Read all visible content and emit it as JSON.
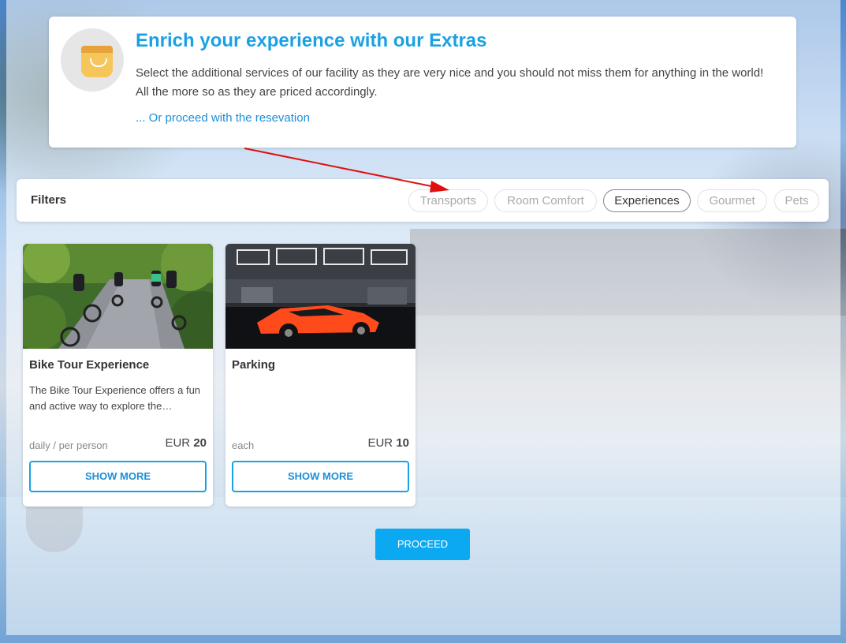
{
  "intro": {
    "title": "Enrich your experience with our Extras",
    "text": "Select the additional services of our facility as they are very nice and you should not miss them for anything in the world! All the more so as they are priced accordingly.",
    "link": "... Or proceed with the resevation",
    "icon": "shopping-bag-icon"
  },
  "filters": {
    "label": "Filters",
    "chips": [
      {
        "label": "Transports",
        "active": false
      },
      {
        "label": "Room Comfort",
        "active": false
      },
      {
        "label": "Experiences",
        "active": true
      },
      {
        "label": "Gourmet",
        "active": false
      },
      {
        "label": "Pets",
        "active": false
      }
    ]
  },
  "cards": [
    {
      "title": "Bike Tour Experience",
      "description": "The Bike Tour Experience offers a fun and active way to explore the…",
      "unit": "daily / per person",
      "currency": "EUR",
      "price": "20",
      "button": "SHOW MORE"
    },
    {
      "title": "Parking",
      "description": "",
      "unit": "each",
      "currency": "EUR",
      "price": "10",
      "button": "SHOW MORE"
    }
  ],
  "proceed": "PROCEED",
  "colors": {
    "accent": "#1ba1e2",
    "proceed": "#0aa9f2",
    "annotation_arrow": "#e01010"
  }
}
